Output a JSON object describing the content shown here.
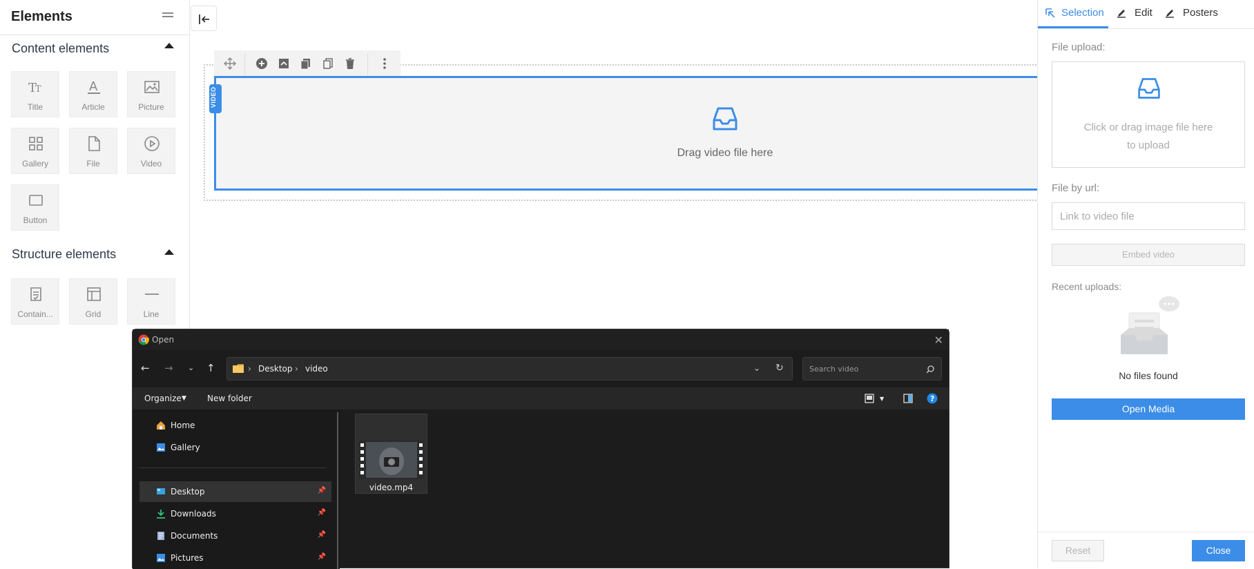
{
  "left_panel": {
    "title": "Elements",
    "content_section": "Content elements",
    "structure_section": "Structure elements",
    "content_items": [
      "Title",
      "Article",
      "Picture",
      "Gallery",
      "File",
      "Video",
      "Button"
    ],
    "structure_items": [
      "Contain...",
      "Grid",
      "Line"
    ]
  },
  "canvas": {
    "video_tag": "VIDEO",
    "drop_text": "Drag video file here"
  },
  "right_panel": {
    "tabs": [
      "Selection",
      "Edit",
      "Posters"
    ],
    "active_tab": "Selection",
    "file_upload_label": "File upload:",
    "upload_hint_line1": "Click or drag image file here",
    "upload_hint_line2": "to upload",
    "file_by_url_label": "File by url:",
    "url_placeholder": "Link to video file",
    "embed_button": "Embed video",
    "recent_uploads_label": "Recent uploads:",
    "no_files": "No files found",
    "open_media": "Open Media",
    "reset": "Reset",
    "close": "Close",
    "accent_color": "#3b8de8"
  },
  "dialog": {
    "title": "Open",
    "path": [
      "Desktop",
      "video"
    ],
    "search_placeholder": "Search video",
    "organize": "Organize",
    "new_folder": "New folder",
    "sidebar": [
      "Home",
      "Gallery",
      "Desktop",
      "Downloads",
      "Documents",
      "Pictures"
    ],
    "selected_sidebar": "Desktop",
    "files": [
      {
        "name": "video.mp4"
      }
    ]
  }
}
